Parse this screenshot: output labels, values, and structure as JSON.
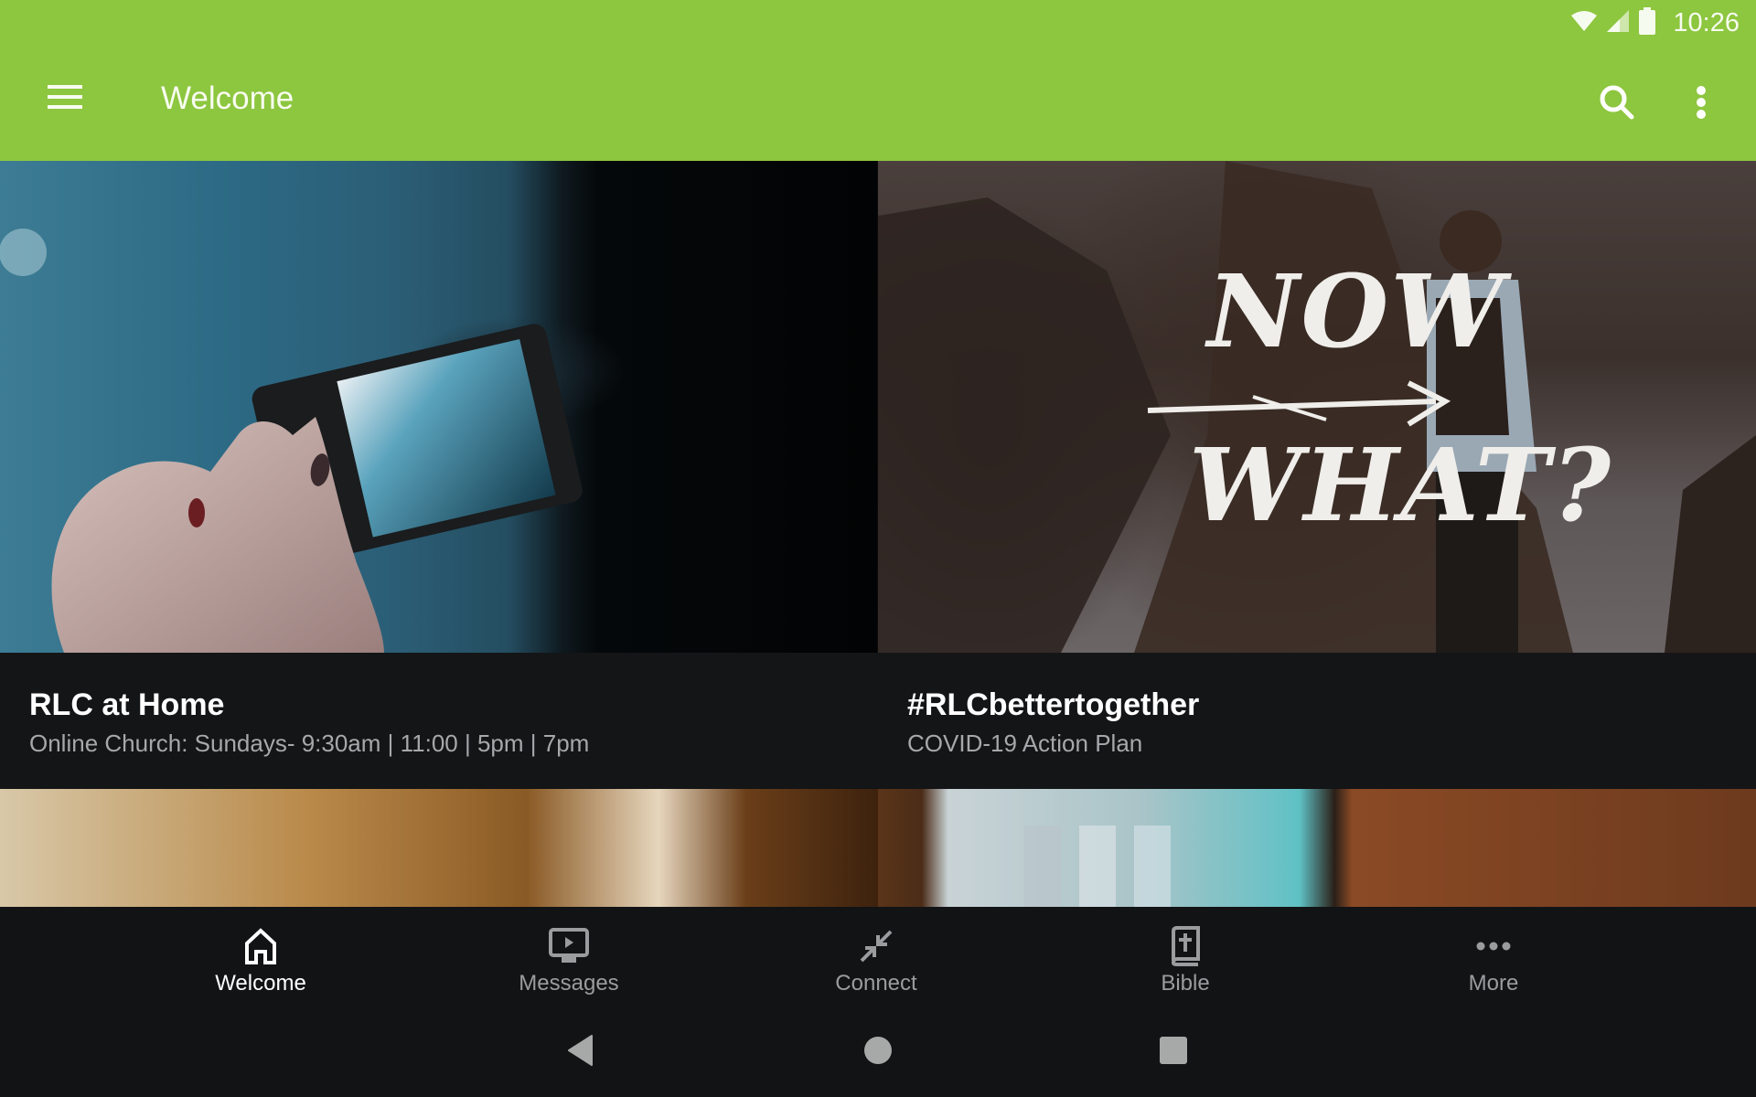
{
  "status_bar": {
    "time": "10:26",
    "icons": [
      "wifi-icon",
      "cell-signal-icon",
      "battery-icon"
    ]
  },
  "app_bar": {
    "title": "Welcome",
    "menu_icon": "hamburger-menu-icon",
    "search_icon": "search-icon",
    "overflow_icon": "more-vert-icon",
    "accent_color": "#8dc63f"
  },
  "cards": [
    {
      "title": "RLC at Home",
      "subtitle": "Online Church: Sundays- 9:30am | 11:00 | 5pm | 7pm",
      "image": "hand holding phone photographing city"
    },
    {
      "title": "#RLCbettertogether",
      "subtitle": "COVID-19 Action Plan",
      "image": "man with backpack on sea cliffs",
      "image_text_line1": "NOW",
      "image_text_line2": "WHAT?"
    },
    {
      "image": "warm blurred close-up"
    },
    {
      "image": "laptop screen on wooden desk"
    }
  ],
  "bottom_nav": {
    "items": [
      {
        "label": "Welcome",
        "icon": "home-icon",
        "active": true
      },
      {
        "label": "Messages",
        "icon": "tv-play-icon",
        "active": false
      },
      {
        "label": "Connect",
        "icon": "connect-arrows-icon",
        "active": false
      },
      {
        "label": "Bible",
        "icon": "bible-icon",
        "active": false
      },
      {
        "label": "More",
        "icon": "more-horiz-icon",
        "active": false
      }
    ]
  },
  "system_nav": {
    "back": "back-icon",
    "home": "home-circle-icon",
    "recents": "recents-square-icon"
  }
}
